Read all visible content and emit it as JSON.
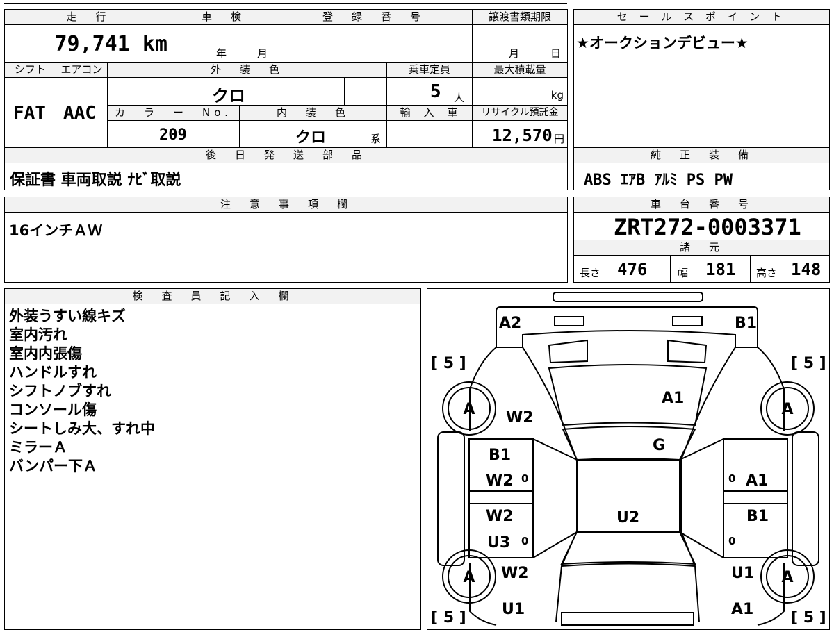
{
  "summary": {
    "headers": {
      "mileage": "走　行",
      "inspection": "車　検",
      "registration": "登　録　番　号",
      "transfer_deadline": "譲渡書類期限",
      "shift": "シフト",
      "aircon": "エアコン",
      "exterior_color": "外　装　色",
      "capacity": "乗車定員",
      "max_load": "最大積載量",
      "color_no": "カ　ラ　ー　No.",
      "interior_color": "内　装　色",
      "import": "輸　入　車",
      "recycle_fee": "リサイクル預託金",
      "later_parts": "後　日　発　送　部　品"
    },
    "values": {
      "mileage": "79,741 km",
      "inspection_year": "年",
      "inspection_month": "月",
      "deadline_month": "月",
      "deadline_day": "日",
      "shift": "FAT",
      "aircon": "AAC",
      "exterior_color": "クロ",
      "capacity": "5",
      "capacity_unit": "人",
      "max_load_unit": "kg",
      "color_no": "209",
      "interior_color": "クロ",
      "interior_suffix": "系",
      "recycle_fee": "12,570",
      "recycle_unit": "円",
      "later_parts": "保証書 車両取説 ﾅﾋﾞ取説"
    }
  },
  "sales_point": {
    "header": "セ ー ル ス ポ イ ン ト",
    "text": "★オークションデビュー★"
  },
  "equipment": {
    "header": "純　正　装　備",
    "text": "ABS ｴｱB ｱﾙﾐ PS PW"
  },
  "caution": {
    "header": "注　意　事　項　欄",
    "text": "16インチＡＷ"
  },
  "chassis": {
    "header": "車　台　番　号",
    "value": "ZRT272-0003371",
    "spec_header": "諸　元",
    "length_label": "長さ",
    "length": "476",
    "width_label": "幅",
    "width": "181",
    "height_label": "高さ",
    "height": "148"
  },
  "inspector": {
    "header": "検　査　員　記　入　欄",
    "notes": [
      "外装うすい線キズ",
      "室内汚れ",
      "室内内張傷",
      "ハンドルすれ",
      "シフトノブすれ",
      "コンソール傷",
      "シートしみ大、すれ中",
      "ミラーＡ",
      "バンパー下Ａ"
    ]
  },
  "diagram": {
    "marks": {
      "front_left": "A2",
      "front_right": "B1",
      "hood": "A1",
      "windshield": "G",
      "left_front_fender": "W2",
      "left_front_door_1": "B1",
      "left_front_door_2": "W2",
      "left_rear_door_1": "W2",
      "left_rear_door_2": "U3",
      "right_front_door": "A1",
      "right_rear_door": "B1",
      "roof": "U2",
      "left_rear_fender": "W2",
      "left_rear_quarter": "U1",
      "right_rear_fender": "U1",
      "right_rear_quarter": "A1",
      "wheel": "A",
      "tire": "[ 5 ]",
      "small_zero": "0"
    }
  }
}
